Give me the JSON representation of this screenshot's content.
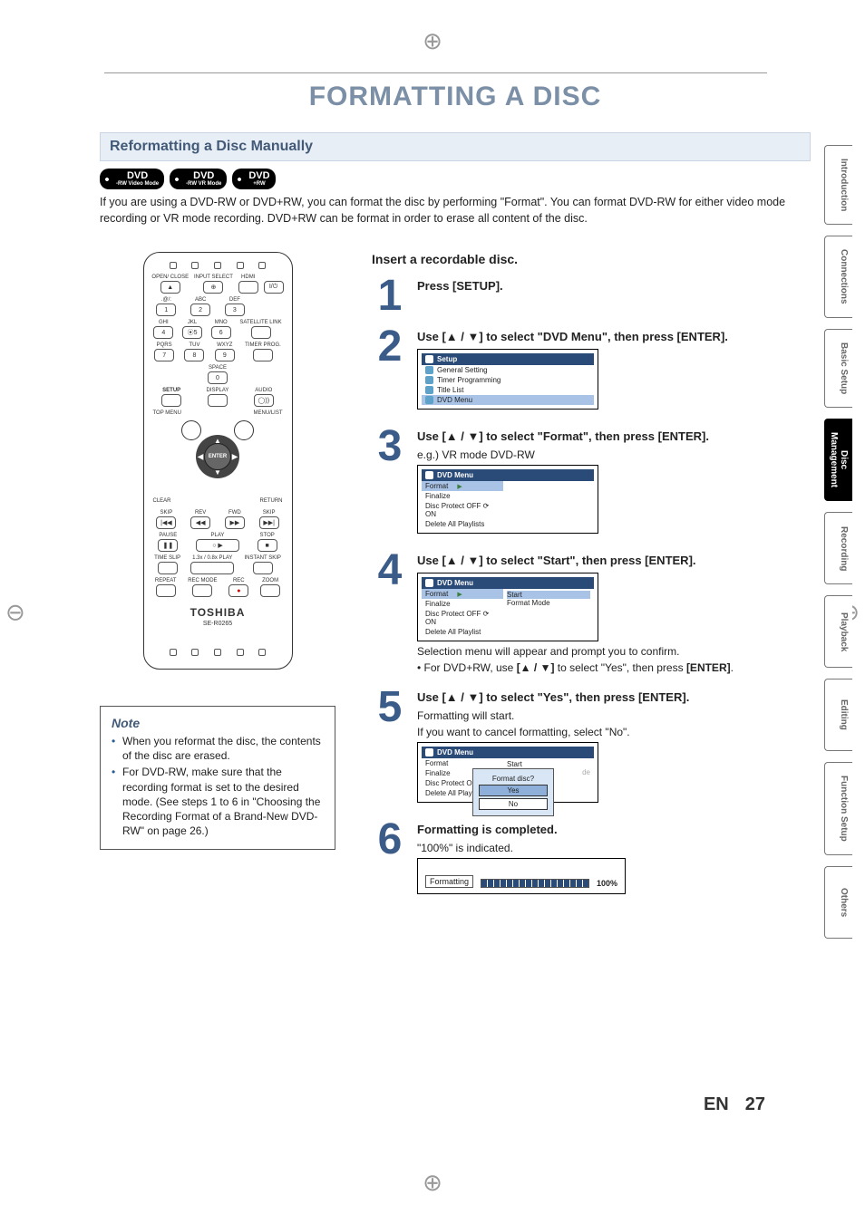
{
  "title": "FORMATTING A DISC",
  "section_heading": "Reformatting a Disc Manually",
  "disc_badges": [
    {
      "top": "DVD",
      "bot": "-RW Video Mode"
    },
    {
      "top": "DVD",
      "bot": "-RW VR Mode"
    },
    {
      "top": "DVD",
      "bot": "+RW"
    }
  ],
  "intro": "If you are using a DVD-RW or DVD+RW, you can format the disc by performing \"Format\". You can format DVD-RW for either video mode recording or VR mode recording. DVD+RW can be format in order to erase all content of the disc.",
  "remote": {
    "top_row1": [
      {
        "lbl": "OPEN/\nCLOSE",
        "glyph": "▲"
      },
      {
        "lbl": "INPUT\nSELECT",
        "glyph": "⊕"
      },
      {
        "lbl": "HDMI",
        "glyph": ""
      },
      {
        "lbl": "",
        "glyph": "I/⏻"
      }
    ],
    "numpad": [
      {
        "lbl": ".@/:",
        "glyph": "1"
      },
      {
        "lbl": "ABC",
        "glyph": "2"
      },
      {
        "lbl": "DEF",
        "glyph": "3"
      },
      {
        "lbl": "GHI",
        "glyph": "4"
      },
      {
        "lbl": "JKL",
        "glyph": "⦿5"
      },
      {
        "lbl": "MNO",
        "glyph": "6"
      },
      {
        "lbl": "PQRS",
        "glyph": "7"
      },
      {
        "lbl": "TUV",
        "glyph": "8"
      },
      {
        "lbl": "WXYZ",
        "glyph": "9"
      }
    ],
    "numpad_side": [
      {
        "lbl": "SATELLITE\nLINK",
        "glyph": ""
      },
      {
        "lbl": "TIMER\nPROG.",
        "glyph": ""
      }
    ],
    "zero_row": [
      {
        "lbl": "SPACE",
        "glyph": "0"
      }
    ],
    "mid_row": [
      {
        "lbl": "SETUP",
        "glyph": "",
        "bold": true
      },
      {
        "lbl": "DISPLAY",
        "glyph": ""
      },
      {
        "lbl": "AUDIO",
        "glyph": "◯))"
      }
    ],
    "corners": {
      "tl": "TOP MENU",
      "tr": "MENU/LIST",
      "bl": "CLEAR",
      "br": "RETURN"
    },
    "enter": "ENTER",
    "transport1": [
      {
        "lbl": "SKIP",
        "glyph": "|◀◀"
      },
      {
        "lbl": "REV",
        "glyph": "◀◀"
      },
      {
        "lbl": "FWD",
        "glyph": "▶▶"
      },
      {
        "lbl": "SKIP",
        "glyph": "▶▶|"
      }
    ],
    "transport2": [
      {
        "lbl": "PAUSE",
        "glyph": "❚❚"
      },
      {
        "lbl": "PLAY",
        "glyph": "○  ▶",
        "wide": true
      },
      {
        "lbl": "STOP",
        "glyph": "■"
      }
    ],
    "transport3": [
      {
        "lbl": "TIME SLIP",
        "glyph": ""
      },
      {
        "lbl": "1.3x / 0.8x PLAY",
        "glyph": "",
        "wide": true
      },
      {
        "lbl": "INSTANT SKIP",
        "glyph": ""
      }
    ],
    "transport4": [
      {
        "lbl": "REPEAT",
        "glyph": ""
      },
      {
        "lbl": "REC MODE",
        "glyph": ""
      },
      {
        "lbl": "REC",
        "glyph": "●"
      },
      {
        "lbl": "ZOOM",
        "glyph": ""
      }
    ],
    "brand": "TOSHIBA",
    "model": "SE-R0265"
  },
  "note": {
    "heading": "Note",
    "items": [
      "When you reformat the disc, the contents of the disc are erased.",
      "For DVD-RW, make sure that the recording format is set to the desired mode. (See steps 1 to 6 in \"Choosing the Recording Format of a Brand-New DVD-RW\" on page 26.)"
    ]
  },
  "insert_heading": "Insert a recordable disc.",
  "steps": {
    "s1": {
      "num": "1",
      "h": "Press [SETUP]."
    },
    "s2": {
      "num": "2",
      "h": "Use [▲ / ▼] to select \"DVD Menu\", then press [ENTER].",
      "screen": {
        "header": "Setup",
        "rows": [
          "General Setting",
          "Timer Programming",
          "Title List",
          "DVD Menu"
        ],
        "sel": 3
      }
    },
    "s3": {
      "num": "3",
      "h": "Use [▲ / ▼] to select \"Format\", then press [ENTER].",
      "sub": "e.g.) VR mode DVD-RW",
      "screen": {
        "header": "DVD Menu",
        "menu": [
          "Format",
          "Finalize",
          "Disc Protect OFF ⟳ ON",
          "Delete All Playlists"
        ],
        "sel": 0
      }
    },
    "s4": {
      "num": "4",
      "h": "Use [▲ / ▼] to select \"Start\", then press [ENTER].",
      "screen": {
        "header": "DVD Menu",
        "menu": [
          "Format",
          "Finalize",
          "Disc Protect OFF ⟳ ON",
          "Delete All Playlist"
        ],
        "sel": 0,
        "pane": [
          "Start",
          "Format Mode"
        ],
        "pane_sel": 0
      },
      "note1": "Selection menu will appear and prompt you to confirm.",
      "note2_pre": "• For DVD+RW, use ",
      "note2_btn": "[▲ / ▼]",
      "note2_mid": " to select \"Yes\", then press ",
      "note2_bold": "[ENTER]",
      "note2_post": "."
    },
    "s5": {
      "num": "5",
      "h": "Use [▲ / ▼] to select \"Yes\", then press [ENTER].",
      "sub": "Formatting will start.",
      "sub2": "If you want to cancel formatting, select \"No\".",
      "screen": {
        "header": "DVD Menu",
        "menu": [
          "Format",
          "Finalize",
          "Disc Protect OFF",
          "Delete All Play"
        ],
        "pane": [
          "Start",
          "de"
        ],
        "dialog": {
          "q": "Format disc?",
          "opts": [
            "Yes",
            "No"
          ],
          "sel": 0
        }
      }
    },
    "s6": {
      "num": "6",
      "h": "Formatting is completed.",
      "sub": "\"100%\" is indicated.",
      "progress": {
        "label": "Formatting",
        "pct": "100%"
      }
    }
  },
  "side_tabs": [
    {
      "label": "Introduction"
    },
    {
      "label": "Connections"
    },
    {
      "label": "Basic Setup"
    },
    {
      "label": "Disc Management",
      "active": true,
      "lines": [
        "Disc",
        "Management"
      ]
    },
    {
      "label": "Recording"
    },
    {
      "label": "Playback"
    },
    {
      "label": "Editing"
    },
    {
      "label": "Function Setup"
    },
    {
      "label": "Others"
    }
  ],
  "footer": {
    "lang": "EN",
    "page": "27"
  }
}
